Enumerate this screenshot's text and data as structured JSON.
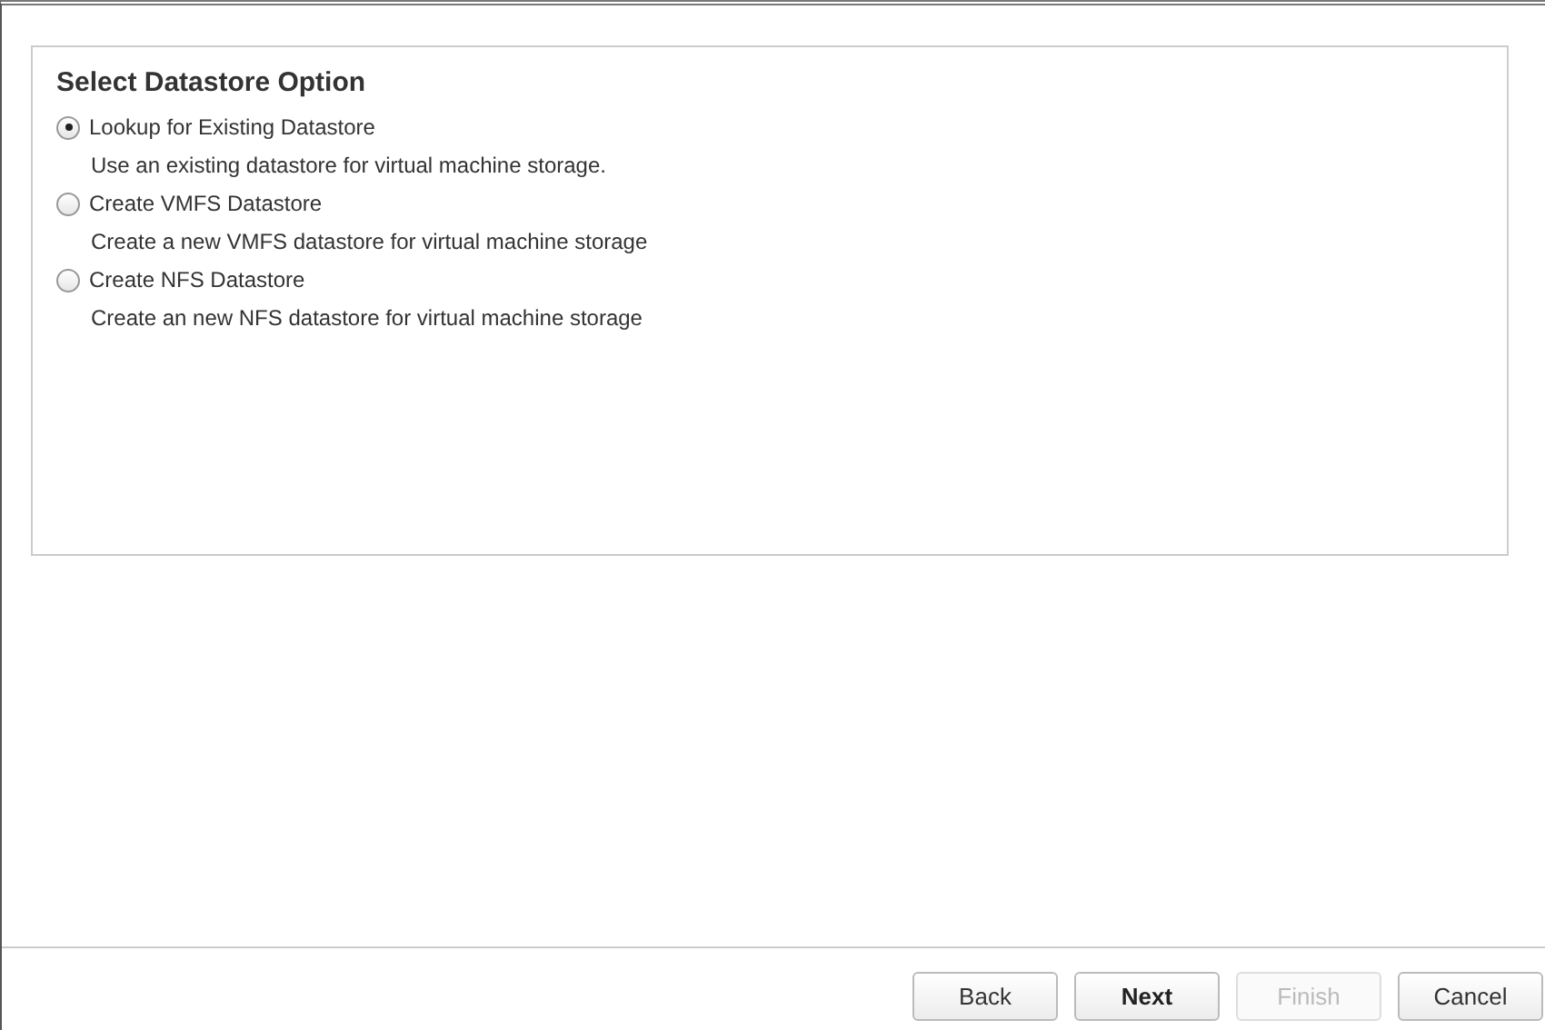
{
  "panel": {
    "title": "Select Datastore Option",
    "options": [
      {
        "label": "Lookup for Existing Datastore",
        "description": "Use an existing datastore for virtual machine storage.",
        "selected": true
      },
      {
        "label": "Create VMFS Datastore",
        "description": "Create a new VMFS datastore for virtual machine storage",
        "selected": false
      },
      {
        "label": "Create NFS Datastore",
        "description": "Create an new NFS datastore for virtual machine storage",
        "selected": false
      }
    ]
  },
  "buttons": [
    {
      "label": "Back",
      "primary": false,
      "disabled": false
    },
    {
      "label": "Next",
      "primary": true,
      "disabled": false
    },
    {
      "label": "Finish",
      "primary": false,
      "disabled": true
    },
    {
      "label": "Cancel",
      "primary": false,
      "disabled": false
    }
  ]
}
